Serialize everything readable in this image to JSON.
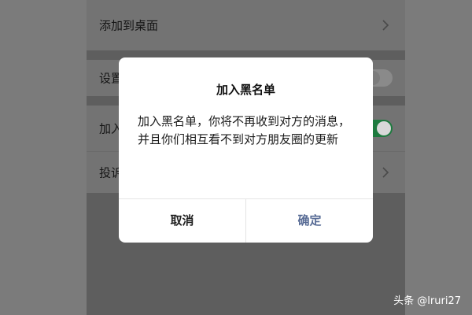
{
  "settings": {
    "rows": [
      {
        "label": "添加到桌面"
      },
      {
        "label": "设置"
      },
      {
        "label": "加入黑名单"
      },
      {
        "label": "投诉"
      }
    ]
  },
  "dialog": {
    "title": "加入黑名单",
    "message": "加入黑名单，你将不再收到对方的消息，并且你们相互看不到对方朋友圈的更新",
    "cancel_label": "取消",
    "confirm_label": "确定",
    "confirm_color": "#576b95"
  },
  "watermark": {
    "text": "头条 @lruri27"
  }
}
